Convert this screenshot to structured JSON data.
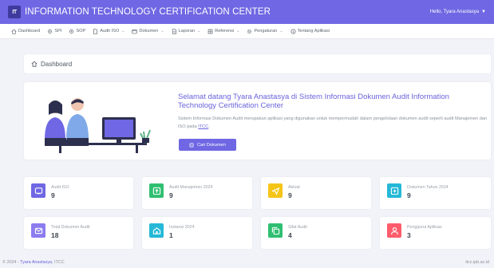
{
  "header": {
    "logo_text": "IT",
    "title": "INFORMATION TECHNOLOGY CERTIFICATION CENTER",
    "user_greeting": "Hello, Tyara Anastasya"
  },
  "menu": {
    "items": [
      {
        "label": "Dashboard",
        "icon": "home-icon",
        "has_dropdown": false
      },
      {
        "label": "SPI",
        "icon": "gear-icon",
        "has_dropdown": false
      },
      {
        "label": "SOP",
        "icon": "gear-icon",
        "has_dropdown": false
      },
      {
        "label": "Audit ISO",
        "icon": "document-icon",
        "has_dropdown": true
      },
      {
        "label": "Dokumen",
        "icon": "folder-icon",
        "has_dropdown": true
      },
      {
        "label": "Laporan",
        "icon": "report-icon",
        "has_dropdown": true
      },
      {
        "label": "Referensi",
        "icon": "grid-icon",
        "has_dropdown": true
      },
      {
        "label": "Pengaturan",
        "icon": "settings-icon",
        "has_dropdown": true
      },
      {
        "label": "Tentang Aplikasi",
        "icon": "info-icon",
        "has_dropdown": false
      }
    ]
  },
  "breadcrumb": {
    "label": "Dashboard"
  },
  "welcome": {
    "title": "Selamat datang Tyara Anastasya di Sistem Informasi Dokumen Audit Information Technology Certification Center",
    "desc_before": "Sistem Informasi Dokumen Audit merupakan aplikasi yang digunakan untuk mempermudah dalam pengelolaan dokumen audit seperti audit Manajemen dan ISO pada ",
    "desc_link": "ITCC",
    "desc_after": ".",
    "button_label": "Cari Dokumen"
  },
  "stats": [
    {
      "label": "Audit ISO",
      "value": "9",
      "color": "#6f67e3",
      "icon": "monitor-icon"
    },
    {
      "label": "Audit Manajemen 2024",
      "value": "9",
      "color": "#2fbf71",
      "icon": "upload-icon"
    },
    {
      "label": "Aktual",
      "value": "9",
      "color": "#f5c518",
      "icon": "send-icon"
    },
    {
      "label": "Dokumen Tahun 2024",
      "value": "9",
      "color": "#25b9d7",
      "icon": "file-plus-icon"
    },
    {
      "label": "Total Dokumen Audit",
      "value": "18",
      "color": "#8b7cf0",
      "icon": "mail-icon"
    },
    {
      "label": "Instansi 2024",
      "value": "1",
      "color": "#25b9d7",
      "icon": "building-icon"
    },
    {
      "label": "Sifat Audit",
      "value": "4",
      "color": "#2fbf71",
      "icon": "copy-icon"
    },
    {
      "label": "Pengguna Aplikasi",
      "value": "3",
      "color": "#ff5c6c",
      "icon": "user-icon"
    }
  ],
  "footer": {
    "copyright": "© 2024 - ",
    "brand": "Tyara Anastasya",
    "suffix": ", ITCC",
    "right": "itcc.ipb.ac.id"
  }
}
